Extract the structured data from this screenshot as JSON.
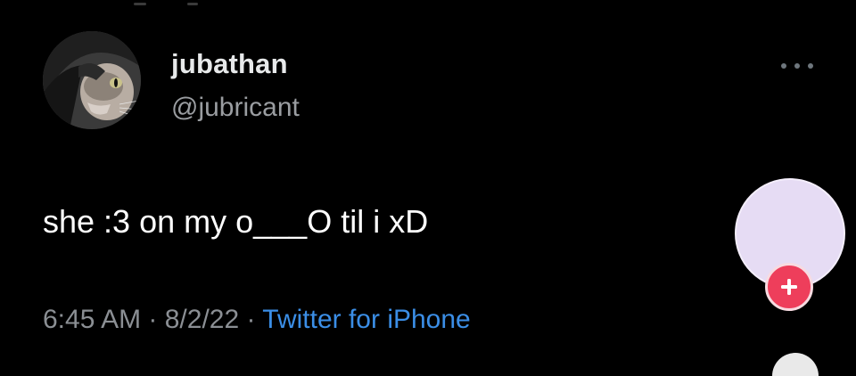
{
  "tweet": {
    "display_name": "jubathan",
    "handle": "@jubricant",
    "text": "she :3 on my o___O til i xD",
    "time": "6:45 AM",
    "separator": " · ",
    "date": "8/2/22",
    "source": "Twitter for iPhone"
  },
  "icons": {
    "more": "ellipsis-icon",
    "add": "plus-icon",
    "avatar": "cat-avatar"
  },
  "colors": {
    "background": "#000000",
    "display_name": "#e7e9ea",
    "handle": "#9a9da1",
    "link": "#3b8ee6",
    "follow_avatar": "#e6dcf4",
    "plus_badge": "#ee3e5b"
  }
}
